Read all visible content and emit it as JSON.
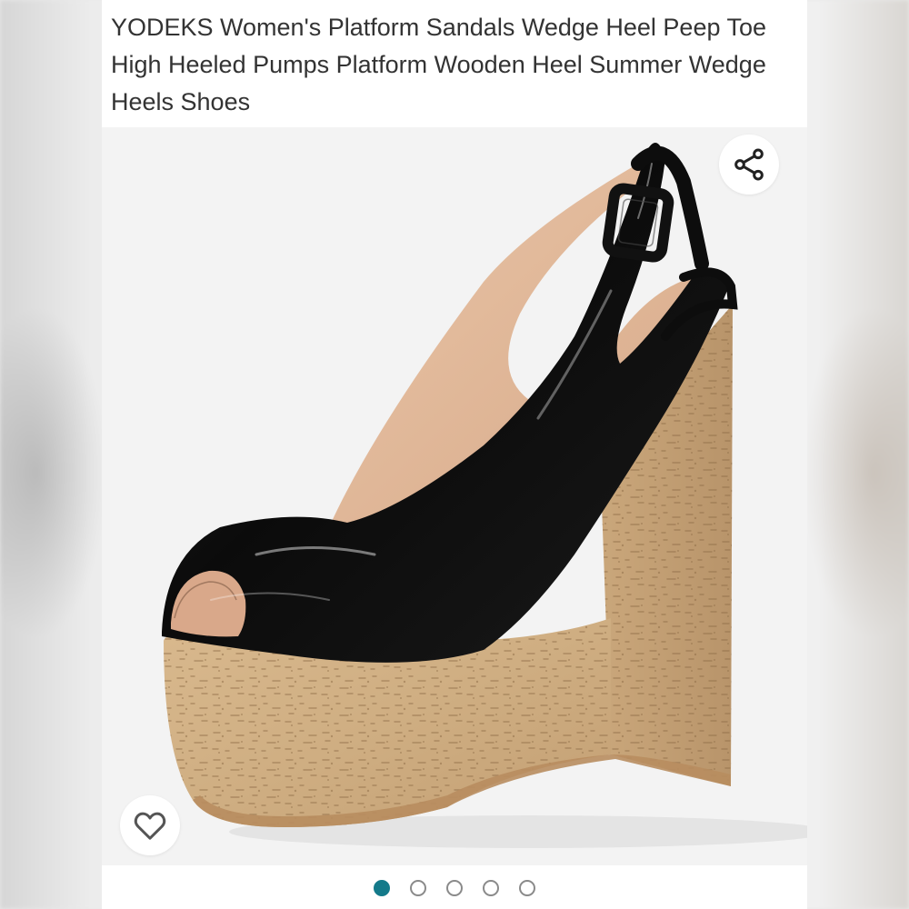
{
  "product": {
    "title": "YODEKS Women's Platform Sandals Wedge Heel Peep Toe High Heeled Pumps Platform Wooden Heel Summer Wedge Heels Shoes"
  },
  "gallery": {
    "image_count": 5,
    "active_index": 0
  },
  "actions": {
    "share_icon": "share-icon",
    "wishlist_icon": "heart-icon"
  },
  "colors": {
    "active_dot": "#147a8a",
    "inactive_dot_border": "#8a8a8a",
    "title_text": "#333333"
  }
}
